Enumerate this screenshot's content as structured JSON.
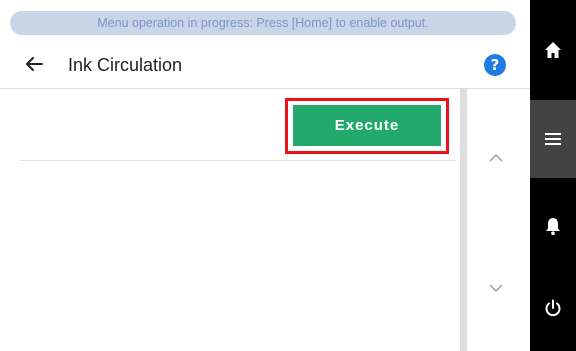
{
  "status": {
    "banner_text": "Menu operation in progress: Press [Home] to enable output."
  },
  "header": {
    "title": "Ink Circulation",
    "back_icon": "arrow-left-icon",
    "help_icon": "help-icon",
    "help_glyph": "?"
  },
  "main": {
    "execute_label": "Execute",
    "highlight_color": "#e8141d",
    "button_color": "#22a96b"
  },
  "scroll": {
    "up_icon": "chevron-up-icon",
    "down_icon": "chevron-down-icon"
  },
  "sidebar": {
    "items": [
      {
        "icon": "home-icon",
        "active": false
      },
      {
        "icon": "menu-icon",
        "active": true
      },
      {
        "icon": "bell-icon",
        "active": false
      },
      {
        "icon": "power-icon",
        "active": false
      }
    ]
  },
  "colors": {
    "banner_bg": "#c9d5e8",
    "banner_text": "#7f96c3",
    "help_blue": "#1f7be0",
    "sidebar_bg": "#000000",
    "sidebar_active": "#434343"
  }
}
